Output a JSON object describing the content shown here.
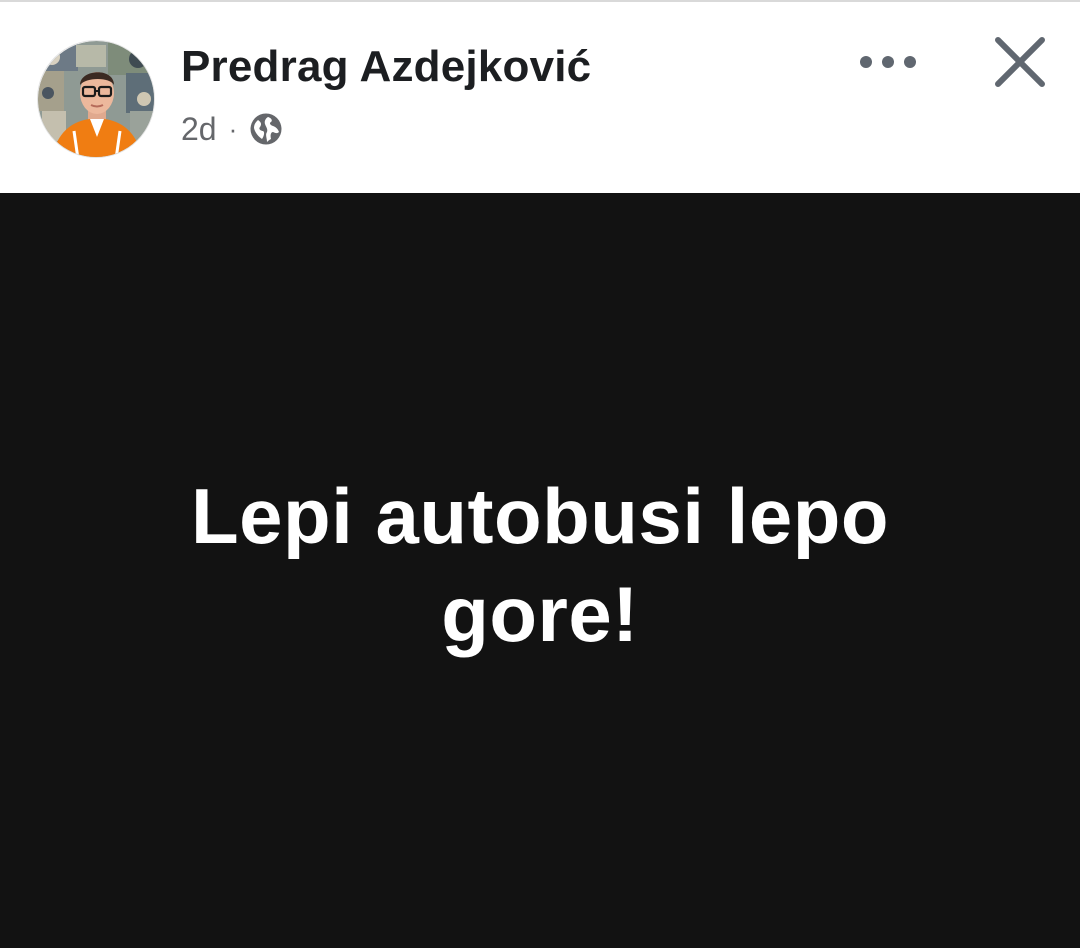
{
  "post": {
    "author": {
      "name": "Predrag Azdejković",
      "avatar_icon": "profile-photo"
    },
    "meta": {
      "time": "2d",
      "separator": "·",
      "privacy_icon": "globe-icon"
    },
    "actions": {
      "more_icon": "more-options-icon",
      "close_icon": "close-icon"
    },
    "content": {
      "text": "Lepi autobusi lepo gore!",
      "background_color": "#121212",
      "text_color": "#ffffff"
    }
  },
  "colors": {
    "name": "#1c1e21",
    "secondary": "#65676b",
    "icon": "#606770"
  }
}
